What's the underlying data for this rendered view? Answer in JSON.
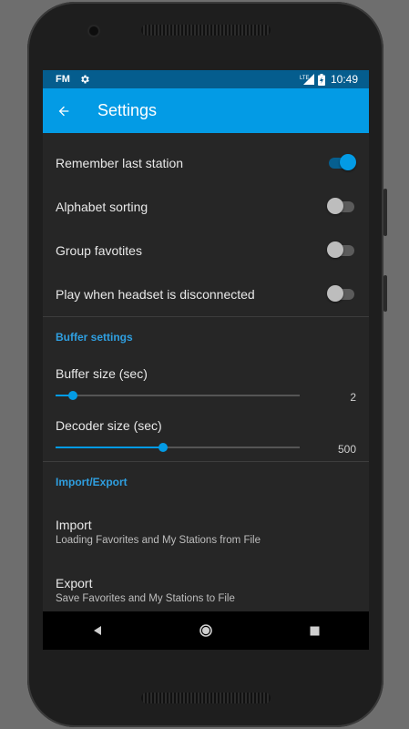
{
  "statusbar": {
    "app_badge": "FM",
    "time": "10:49",
    "network": "LTE"
  },
  "appbar": {
    "title": "Settings"
  },
  "toggles": [
    {
      "label": "Remember last station",
      "on": true
    },
    {
      "label": "Alphabet sorting",
      "on": false
    },
    {
      "label": "Group favotites",
      "on": false
    },
    {
      "label": "Play when headset is disconnected",
      "on": false
    }
  ],
  "buffer_section": {
    "title": "Buffer settings"
  },
  "sliders": [
    {
      "label": "Buffer size (sec)",
      "value": "2",
      "fraction": 0.07
    },
    {
      "label": "Decoder size (sec)",
      "value": "500",
      "fraction": 0.44
    }
  ],
  "import_section": {
    "title": "Import/Export"
  },
  "items": [
    {
      "title": "Import",
      "subtitle": "Loading Favorites and My Stations from File"
    },
    {
      "title": "Export",
      "subtitle": "Save Favorites and My Stations to File"
    }
  ],
  "colors": {
    "accent": "#039be5",
    "statusbar": "#055d8e",
    "background": "#262626",
    "section": "#2f9fe0"
  }
}
